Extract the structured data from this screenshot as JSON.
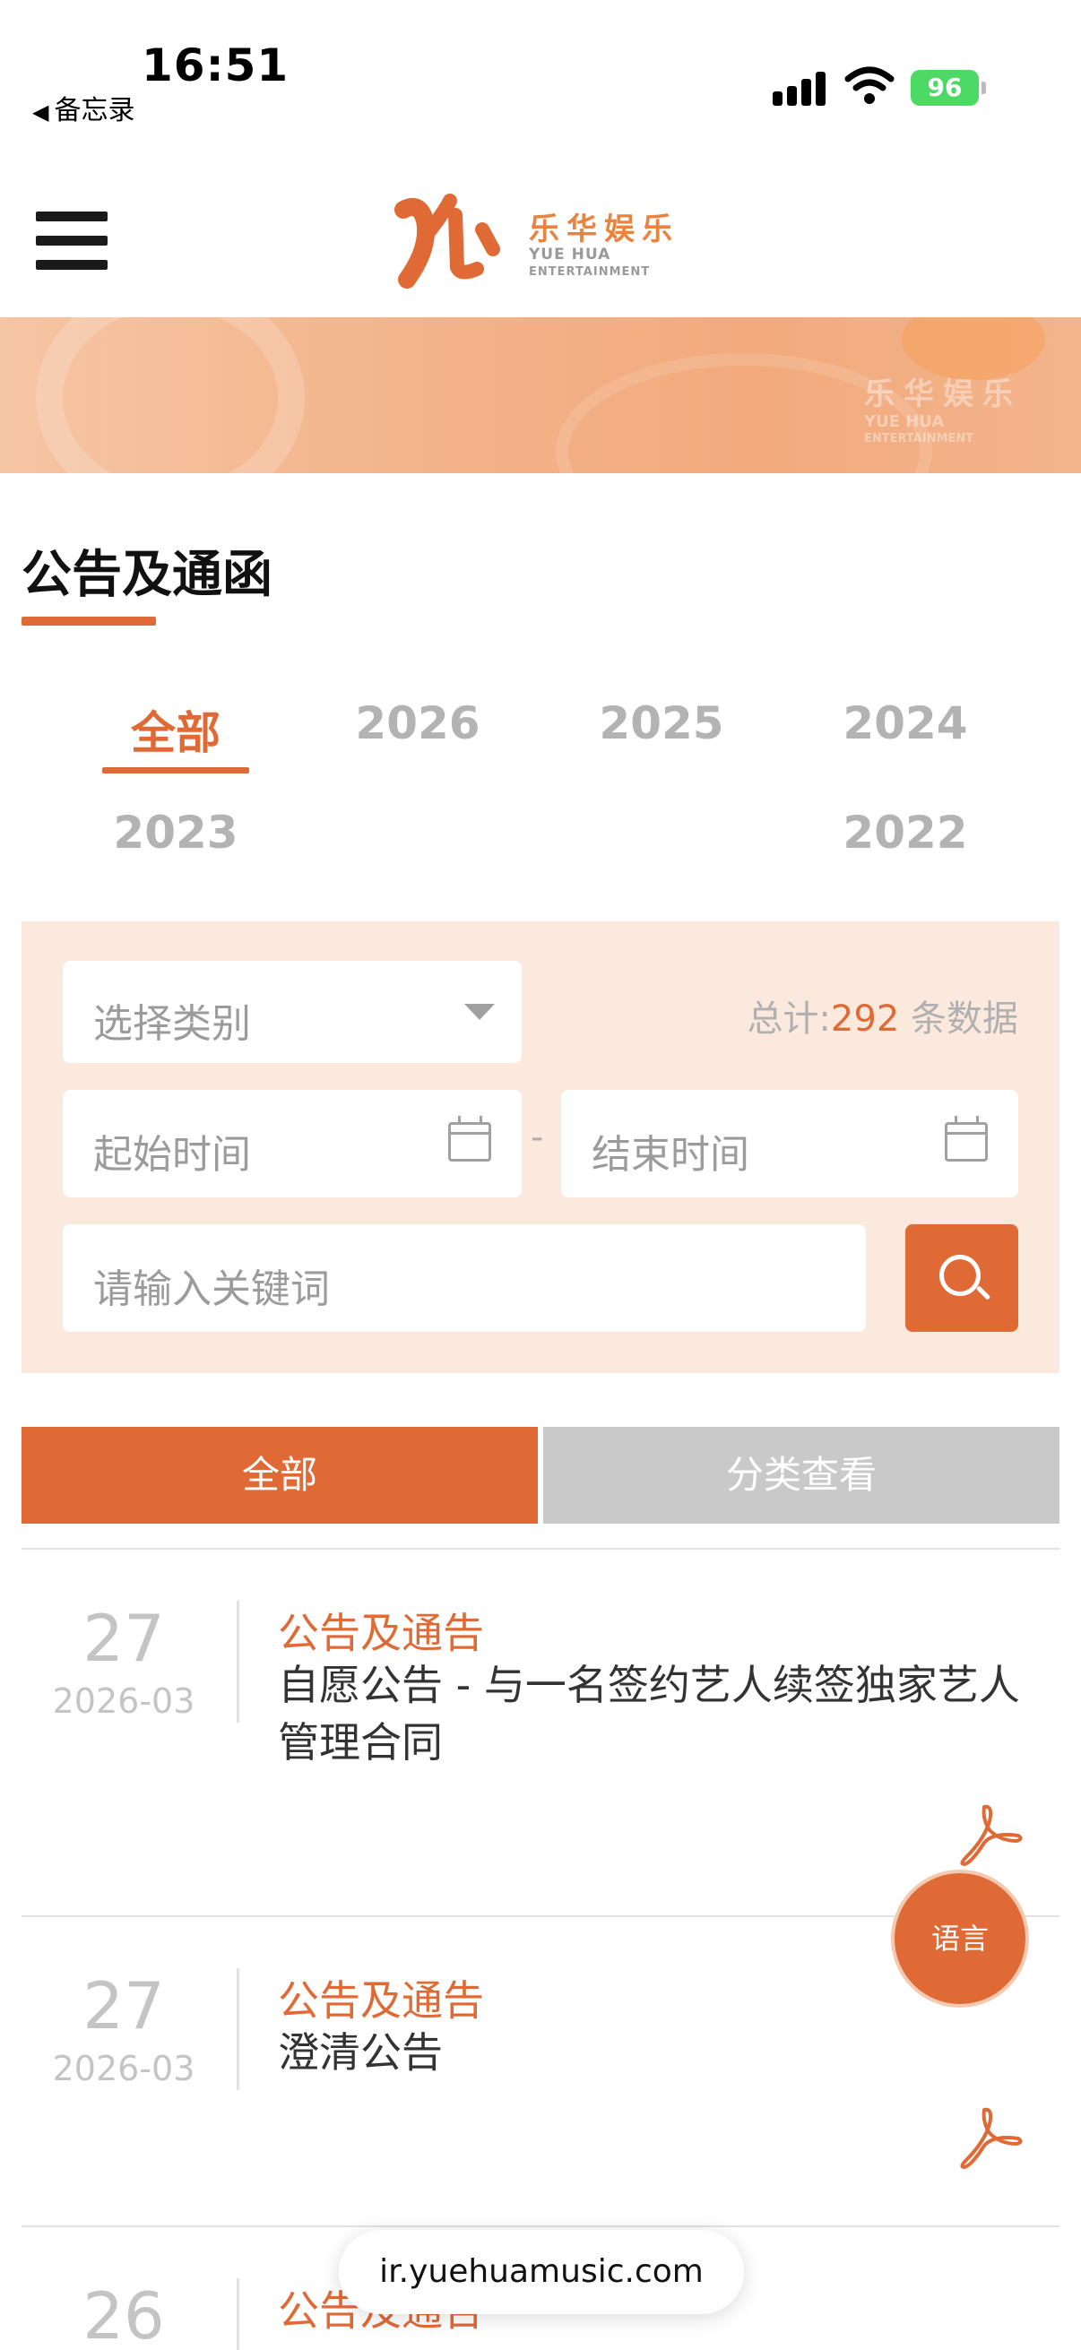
{
  "status_bar": {
    "time": "16:51",
    "back_label": "备忘录",
    "battery": "96"
  },
  "logo": {
    "cn": "乐华娱乐",
    "en_line1": "YUE HUA",
    "en_line2": "ENTERTAINMENT"
  },
  "banner": {
    "cn": "乐华娱乐",
    "en_line1": "YUE HUA",
    "en_line2": "ENTERTAINMENT"
  },
  "page_title": "公告及通函",
  "year_tabs": [
    "全部",
    "2026",
    "2025",
    "2024",
    "2023",
    "2022"
  ],
  "filter": {
    "category_placeholder": "选择类别",
    "total_prefix": "总计:",
    "total_count": "292",
    "total_suffix": " 条数据",
    "start_placeholder": "起始时间",
    "dash": "-",
    "end_placeholder": "结束时间",
    "keyword_placeholder": "请输入关键词"
  },
  "view_tabs": {
    "all": "全部",
    "by_category": "分类查看"
  },
  "items": [
    {
      "day": "27",
      "date": "2026-03",
      "category": "公告及通告",
      "title": "自愿公告 - 与一名签约艺人续签独家艺人管理合同"
    },
    {
      "day": "27",
      "date": "2026-03",
      "category": "公告及通告",
      "title": "澄清公告"
    },
    {
      "day": "26",
      "date": "",
      "category": "公告及通告",
      "title": ""
    }
  ],
  "language_button": "语言",
  "url": "ir.yuehuamusic.com",
  "colors": {
    "accent": "#e06a36",
    "panel_bg": "#fce9de",
    "inactive_tab": "#c9c9c9"
  },
  "icons": [
    "hamburger-menu-icon",
    "dropdown-caret-icon",
    "calendar-icon",
    "search-icon",
    "pdf-icon"
  ]
}
